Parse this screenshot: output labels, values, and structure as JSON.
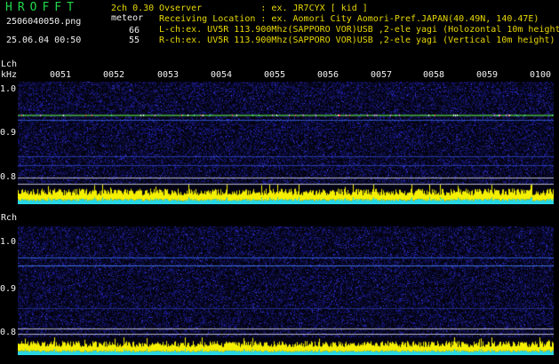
{
  "header": {
    "logo": "HROFFT",
    "filename": "2506040050.png",
    "datetime": "25.06.04 00:50",
    "version": "2ch 0.30",
    "meteor_label": "meteor",
    "meteor_count_l": "66",
    "meteor_count_r": "55"
  },
  "info": {
    "observer": "Ovserver           : ex. JR7CYX [ kid ]",
    "location": "Receiving Location : ex. Aomori City Aomori-Pref.JAPAN(40.49N, 140.47E)",
    "lch": "L-ch:ex. UV5R 113.900Mhz(SAPPORO VOR)USB ,2-ele yagi (Holozontal 10m height)",
    "rch": "R-ch:ex. UV5R 113.900Mhz(SAPPORO VOR)USB ,2-ele yagi (Vertical 10m height)"
  },
  "panels": {
    "lch_label": "Lch",
    "khz_label": "kHz",
    "rch_label": "Rch",
    "yticks": [
      "1.0",
      "0.9",
      "0.8"
    ]
  },
  "time_labels": [
    "0051",
    "0052",
    "0053",
    "0054",
    "0055",
    "0056",
    "0057",
    "0058",
    "0059",
    "0100"
  ],
  "colors": {
    "text_green": "#22d84a",
    "text_yellow": "#e8d800",
    "text_white": "#f0f0f0",
    "waterfall_bg": "#030312",
    "amplitude_yellow": "#f5f000",
    "amplitude_cyan": "#28d7e6"
  }
}
